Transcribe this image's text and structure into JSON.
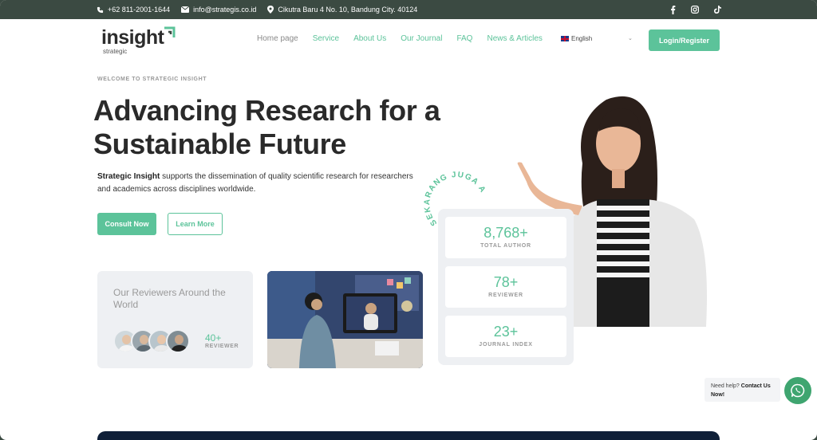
{
  "topbar": {
    "phone": "+62 811-2001-1644",
    "email": "info@strategis.co.id",
    "address": "Cikutra Baru 4 No. 10, Bandung City. 40124",
    "social_icons": [
      "facebook-icon",
      "instagram-icon",
      "tiktok-icon"
    ]
  },
  "brand": {
    "logo_text": "insight",
    "logo_sub": "strategic",
    "accent_color": "#5cc39a",
    "dark_color": "#3b4a42"
  },
  "nav": {
    "items": [
      "Home page",
      "Service",
      "About Us",
      "Our Journal",
      "FAQ",
      "News & Articles"
    ],
    "language": "English",
    "login_label": "Login/Register"
  },
  "hero": {
    "eyebrow": "WELCOME TO STRATEGIC INSIGHT",
    "title_line1": "Advancing Research for a",
    "title_line2": "Sustainable Future",
    "desc_bold": "Strategic Insight",
    "desc_rest": " supports the dissemination of quality scientific research for researchers and academics across disciplines worldwide.",
    "consult_label": "Consult Now",
    "learn_label": "Learn More",
    "circle_text": "SEKARANG JUGA AYO"
  },
  "reviewers": {
    "title": "Our Reviewers Around the World",
    "count": "40+",
    "label": "REVIEWER"
  },
  "stats": [
    {
      "value": "8,768+",
      "label": "TOTAL AUTHOR"
    },
    {
      "value": "78+",
      "label": "REVIEWER"
    },
    {
      "value": "23+",
      "label": "JOURNAL INDEX"
    }
  ],
  "help": {
    "prefix": "Need help? ",
    "bold": "Contact Us Now!"
  }
}
